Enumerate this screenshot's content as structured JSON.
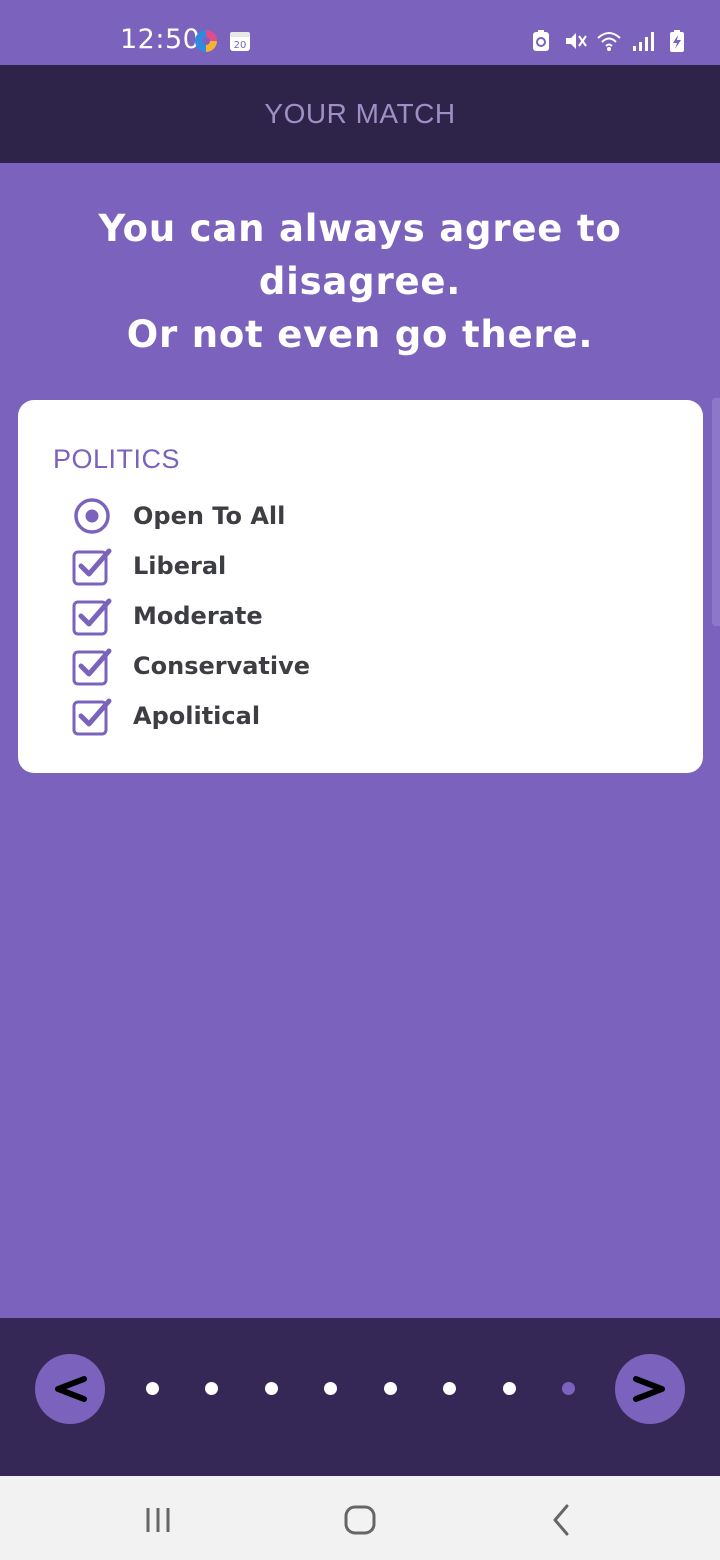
{
  "status_bar": {
    "time": "12:50",
    "calendar_day": "20",
    "left_icons": [
      "edge-browser-icon",
      "calendar-icon"
    ],
    "right_icons": [
      "battery-saver-icon",
      "vibrate-mute-icon",
      "wifi-icon",
      "signal-icon",
      "battery-charging-icon"
    ]
  },
  "header": {
    "title": "YOUR MATCH"
  },
  "headline": {
    "line1": "You can always agree to disagree.",
    "line2": "Or not even go there."
  },
  "card": {
    "section_title": "POLITICS",
    "options": [
      {
        "label": "Open To All",
        "control": "radio",
        "checked": true
      },
      {
        "label": "Liberal",
        "control": "checkbox",
        "checked": true
      },
      {
        "label": "Moderate",
        "control": "checkbox",
        "checked": true
      },
      {
        "label": "Conservative",
        "control": "checkbox",
        "checked": true
      },
      {
        "label": "Apolitical",
        "control": "checkbox",
        "checked": true
      }
    ]
  },
  "pager": {
    "prev_icon": "chevron-left-icon",
    "next_icon": "chevron-right-icon",
    "total_pages": 8,
    "current_page": 8
  },
  "system_nav": {
    "icons": [
      "recent-apps-icon",
      "home-icon",
      "back-icon"
    ]
  },
  "colors": {
    "background": "#7b63bd",
    "header": "#2e2449",
    "pager_bar": "#352856",
    "accent": "#7b63bd",
    "card": "#ffffff"
  }
}
